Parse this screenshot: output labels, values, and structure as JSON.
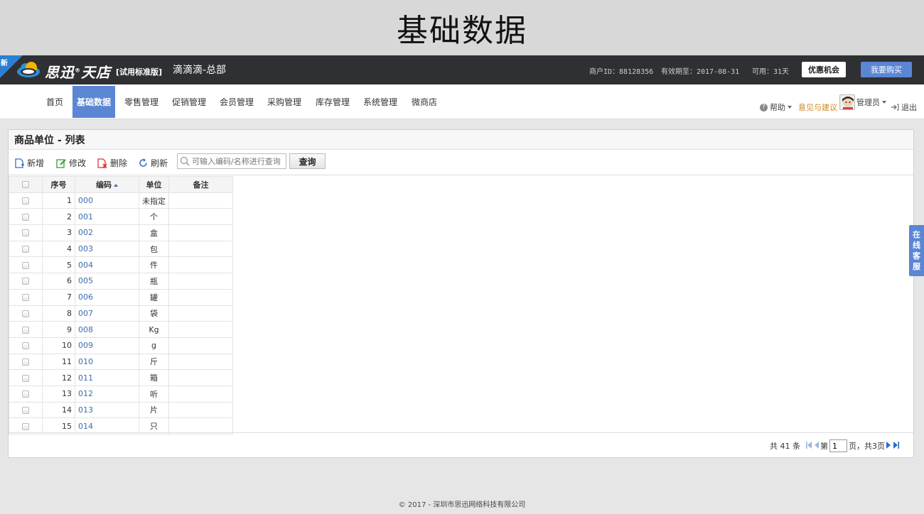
{
  "slide_title": "基础数据",
  "topbar": {
    "new_badge": "新",
    "brand": "思迅",
    "brand_reg": "®",
    "brand2": "天店",
    "edition": "[试用标准版]",
    "store_name": "滴滴滴-总部",
    "merchant_id": "商户ID：88128356",
    "valid_until": "有效期至：2017-08-31",
    "available": "可用：31天",
    "offer_label": "优惠机会",
    "buy_label": "我要购买"
  },
  "nav": {
    "items": [
      "首页",
      "基础数据",
      "零售管理",
      "促销管理",
      "会员管理",
      "采购管理",
      "库存管理",
      "系统管理",
      "微商店"
    ],
    "active_index": 1,
    "help": "帮助",
    "feedback": "意见与建议",
    "user": "管理员",
    "logout": "退出"
  },
  "panel": {
    "title": "商品单位 - 列表",
    "toolbar": {
      "add": "新增",
      "edit": "修改",
      "delete": "删除",
      "refresh": "刷新",
      "search_placeholder": "可输入编码/名称进行查询",
      "search_btn": "查询"
    },
    "columns": [
      "序号",
      "编码",
      "单位",
      "备注"
    ],
    "rows": [
      {
        "no": "1",
        "code": "000",
        "unit": "未指定",
        "note": ""
      },
      {
        "no": "2",
        "code": "001",
        "unit": "个",
        "note": ""
      },
      {
        "no": "3",
        "code": "002",
        "unit": "盒",
        "note": ""
      },
      {
        "no": "4",
        "code": "003",
        "unit": "包",
        "note": ""
      },
      {
        "no": "5",
        "code": "004",
        "unit": "件",
        "note": ""
      },
      {
        "no": "6",
        "code": "005",
        "unit": "瓶",
        "note": ""
      },
      {
        "no": "7",
        "code": "006",
        "unit": "罐",
        "note": ""
      },
      {
        "no": "8",
        "code": "007",
        "unit": "袋",
        "note": ""
      },
      {
        "no": "9",
        "code": "008",
        "unit": "Kg",
        "note": ""
      },
      {
        "no": "10",
        "code": "009",
        "unit": "g",
        "note": ""
      },
      {
        "no": "11",
        "code": "010",
        "unit": "斤",
        "note": ""
      },
      {
        "no": "12",
        "code": "011",
        "unit": "箱",
        "note": ""
      },
      {
        "no": "13",
        "code": "012",
        "unit": "听",
        "note": ""
      },
      {
        "no": "14",
        "code": "013",
        "unit": "片",
        "note": ""
      },
      {
        "no": "15",
        "code": "014",
        "unit": "只",
        "note": ""
      }
    ],
    "pager": {
      "total": "共 41 条",
      "page_prefix": "第",
      "page_value": "1",
      "page_suffix": "页，共3页"
    }
  },
  "service_tab": [
    "在",
    "线",
    "客",
    "服"
  ],
  "footer": "© 2017 - 深圳市思迅网络科技有限公司",
  "colors": {
    "accent": "#5b86d4",
    "topbar": "#2f3033",
    "link": "#3c6db0",
    "feedback": "#d08a1c"
  }
}
